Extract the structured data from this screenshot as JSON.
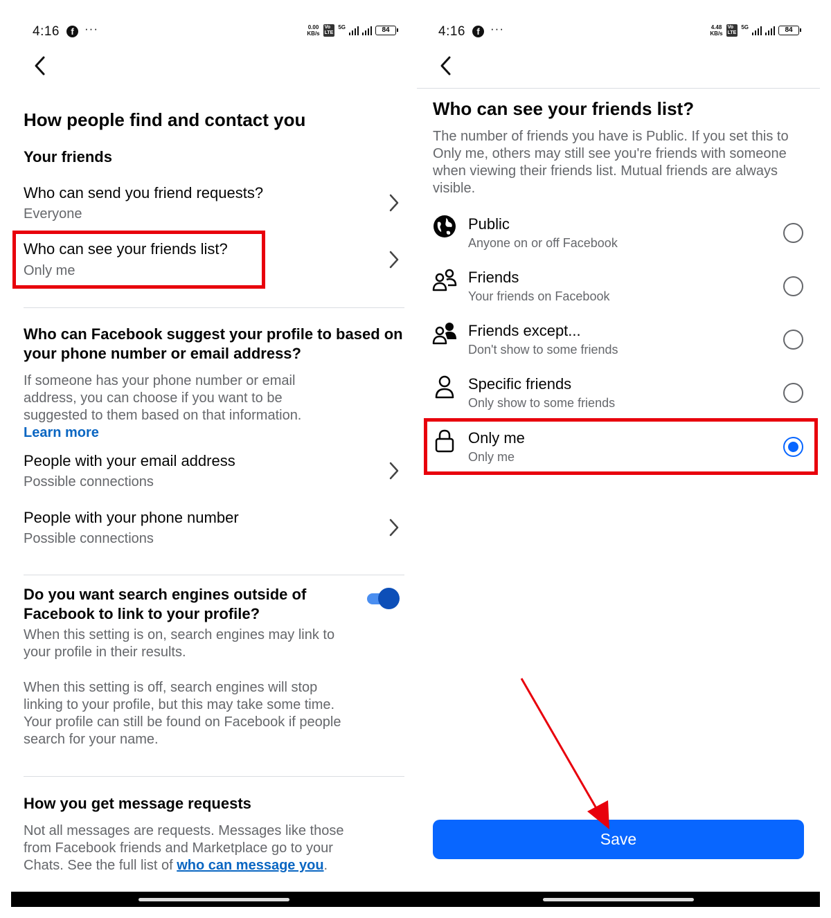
{
  "left": {
    "status": {
      "time": "4:16",
      "dots": "···",
      "speed_value": "0.00",
      "speed_unit": "KB/s",
      "network": "5G",
      "battery": "84"
    },
    "page_title": "How people find and contact you",
    "section_friends": "Your friends",
    "rows_friends": [
      {
        "title": "Who can send you friend requests?",
        "subtitle": "Everyone"
      },
      {
        "title": "Who can see your friends list?",
        "subtitle": "Only me"
      }
    ],
    "section_suggest": "Who can Facebook suggest your profile to based on your phone number or email address?",
    "suggest_desc": "If someone has your phone number or email address, you can choose if you want to be suggested to them based on that information.",
    "learn_more": "Learn more",
    "rows_contact": [
      {
        "title": "People with your email address",
        "subtitle": "Possible connections"
      },
      {
        "title": "People with your phone number",
        "subtitle": "Possible connections"
      }
    ],
    "section_search": "Do you want search engines outside of Facebook to link to your profile?",
    "search_on": "When this setting is on, search engines may link to your profile in their results.",
    "search_off": "When this setting is off, search engines will stop linking to your profile, but this may take some time. Your profile can still be found on Facebook if people search for your name.",
    "search_toggle_on": true,
    "section_messages": "How you get message requests",
    "messages_desc": "Not all messages are requests. Messages like those from Facebook friends and Marketplace go to your Chats. See the full list of ",
    "messages_link": "who can message you",
    "messages_end": "."
  },
  "right": {
    "status": {
      "time": "4:16",
      "dots": "···",
      "speed_value": "4.48",
      "speed_unit": "KB/s",
      "network": "5G",
      "battery": "84"
    },
    "title": "Who can see your friends list?",
    "description": "The number of friends you have is Public. If you set this to Only me, others may still see you're friends with someone when viewing their friends list. Mutual friends are always visible.",
    "options": [
      {
        "icon": "globe-icon",
        "title": "Public",
        "subtitle": "Anyone on or off Facebook",
        "selected": false
      },
      {
        "icon": "friends-icon",
        "title": "Friends",
        "subtitle": "Your friends on Facebook",
        "selected": false
      },
      {
        "icon": "friends-except-icon",
        "title": "Friends except...",
        "subtitle": "Don't show to some friends",
        "selected": false
      },
      {
        "icon": "person-icon",
        "title": "Specific friends",
        "subtitle": "Only show to some friends",
        "selected": false
      },
      {
        "icon": "lock-icon",
        "title": "Only me",
        "subtitle": "Only me",
        "selected": true
      }
    ],
    "save_label": "Save"
  },
  "colors": {
    "accent": "#0866ff",
    "highlight": "#e8000c",
    "link": "#0a66c2",
    "secondary_text": "#65676b"
  }
}
